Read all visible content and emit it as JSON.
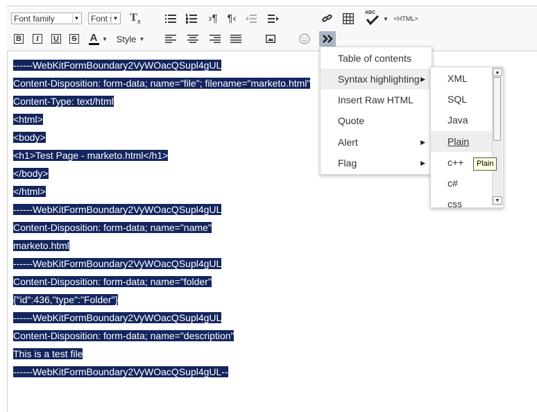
{
  "toolbar": {
    "font_family_label": "Font family",
    "font_size_label": "Font si",
    "style_label": "Style",
    "html_label": "<HTML>",
    "spellcheck_label": "ABC",
    "bold_label": "B",
    "italic_label": "I",
    "underline_label": "U",
    "strike_label": "S",
    "font_color_label": "A",
    "clear_format_label": "T",
    "clear_format_sub": "x"
  },
  "content": {
    "lines": [
      "------WebKitFormBoundary2VyWOacQSupl4gUL",
      "Content-Disposition: form-data; name=\"file\"; filename=\"marketo.html\"",
      "Content-Type: text/html",
      "<html>",
      "<body>",
      "<h1>Test Page - marketo.html</h1>",
      "</body>",
      "</html>",
      "------WebKitFormBoundary2VyWOacQSupl4gUL",
      "Content-Disposition: form-data; name=\"name\"",
      "marketo.html",
      "------WebKitFormBoundary2VyWOacQSupl4gUL",
      "Content-Disposition: form-data; name=\"folder\"",
      "{\"id\":436,\"type\":\"Folder\"}",
      "------WebKitFormBoundary2VyWOacQSupl4gUL",
      "Content-Disposition: form-data; name=\"description\"",
      "This is a test file",
      "------WebKitFormBoundary2VyWOacQSupl4gUL--"
    ]
  },
  "menu": {
    "items": [
      {
        "label": "Table of contents",
        "has_submenu": false
      },
      {
        "label": "Syntax highlighting",
        "has_submenu": true
      },
      {
        "label": "Insert Raw HTML",
        "has_submenu": false
      },
      {
        "label": "Quote",
        "has_submenu": false
      },
      {
        "label": "Alert",
        "has_submenu": true
      },
      {
        "label": "Flag",
        "has_submenu": true
      }
    ],
    "active_item": "Syntax highlighting"
  },
  "submenu": {
    "items": [
      "XML",
      "SQL",
      "Java",
      "Plain",
      "c++",
      "c#",
      "css"
    ],
    "active_item": "Plain"
  },
  "tooltip": {
    "text": "Plain"
  },
  "colors": {
    "selection_bg": "#14265e",
    "selection_text": "#ffffff",
    "toolbar_bg": "#f8f8f8",
    "more_button_bg": "#aab6c4",
    "menu_hover_bg": "#eeeeee",
    "tooltip_bg": "#ffffe1"
  },
  "icons": [
    "clear-format-icon",
    "bullet-list-icon",
    "numbered-list-icon",
    "ltr-paragraph-icon",
    "rtl-paragraph-icon",
    "outdent-icon",
    "indent-icon",
    "link-icon",
    "table-icon",
    "spellcheck-icon",
    "html-source-icon",
    "bold-icon",
    "italic-icon",
    "underline-icon",
    "strikethrough-icon",
    "font-color-icon",
    "align-left-icon",
    "align-center-icon",
    "align-right-icon",
    "justify-icon",
    "image-icon",
    "emoji-icon",
    "more-icon"
  ]
}
